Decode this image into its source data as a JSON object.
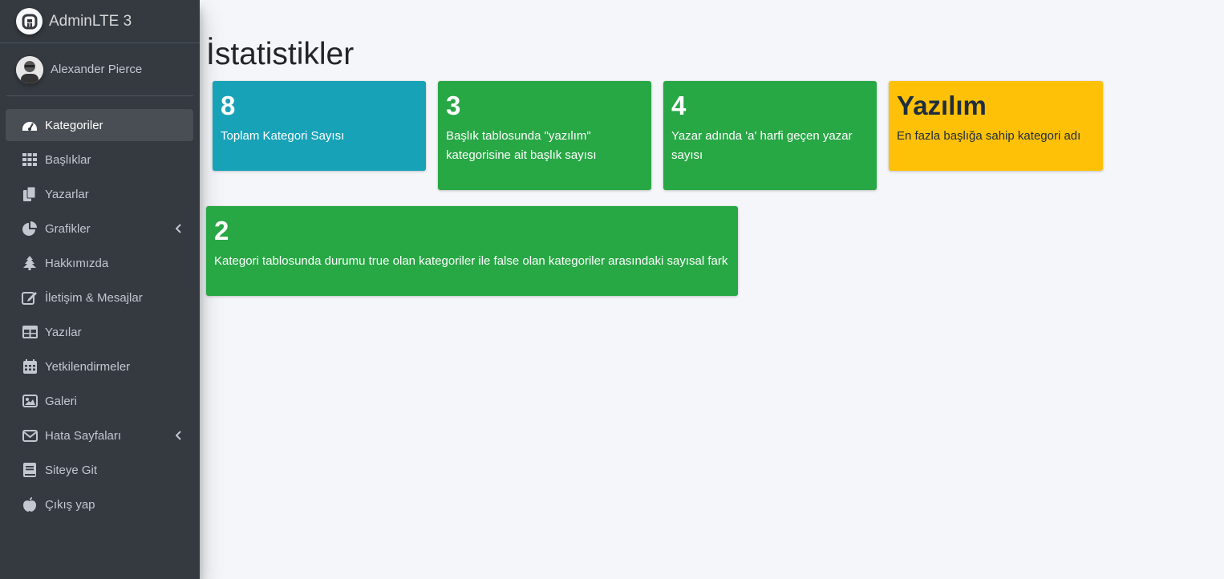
{
  "brand": {
    "name": "AdminLTE 3"
  },
  "user": {
    "name": "Alexander Pierce"
  },
  "sidebar": {
    "items": [
      {
        "label": "Kategoriler",
        "icon": "tachometer-icon",
        "active": true
      },
      {
        "label": "Başlıklar",
        "icon": "grid-icon"
      },
      {
        "label": "Yazarlar",
        "icon": "copy-icon"
      },
      {
        "label": "Grafikler",
        "icon": "pie-chart-icon",
        "has_submenu": true
      },
      {
        "label": "Hakkımızda",
        "icon": "tree-icon"
      },
      {
        "label": "İletişim & Mesajlar",
        "icon": "edit-icon"
      },
      {
        "label": "Yazılar",
        "icon": "table-icon"
      },
      {
        "label": "Yetkilendirmeler",
        "icon": "calendar-icon"
      },
      {
        "label": "Galeri",
        "icon": "image-icon"
      },
      {
        "label": "Hata Sayfaları",
        "icon": "envelope-icon",
        "has_submenu": true
      },
      {
        "label": "Siteye Git",
        "icon": "book-icon"
      },
      {
        "label": "Çıkış yap",
        "icon": "apple-icon"
      }
    ]
  },
  "page": {
    "title": "İstatistikler"
  },
  "stats": [
    {
      "value": "8",
      "label": "Toplam Kategori Sayısı",
      "color": "#17a2b8"
    },
    {
      "value": "3",
      "label": "Başlık tablosunda \"yazılım\" kategorisine ait başlık sayısı",
      "color": "#28a745"
    },
    {
      "value": "4",
      "label": "Yazar adında 'a' harfi geçen yazar sayısı",
      "color": "#28a745"
    },
    {
      "value": "Yazılım",
      "label": "En fazla başlığa sahip kategori adı",
      "color": "#ffc107"
    },
    {
      "value": "2",
      "label": "Kategori tablosunda durumu true olan kategoriler ile false olan kategoriler arasındaki sayısal fark",
      "color": "#28a745"
    }
  ]
}
